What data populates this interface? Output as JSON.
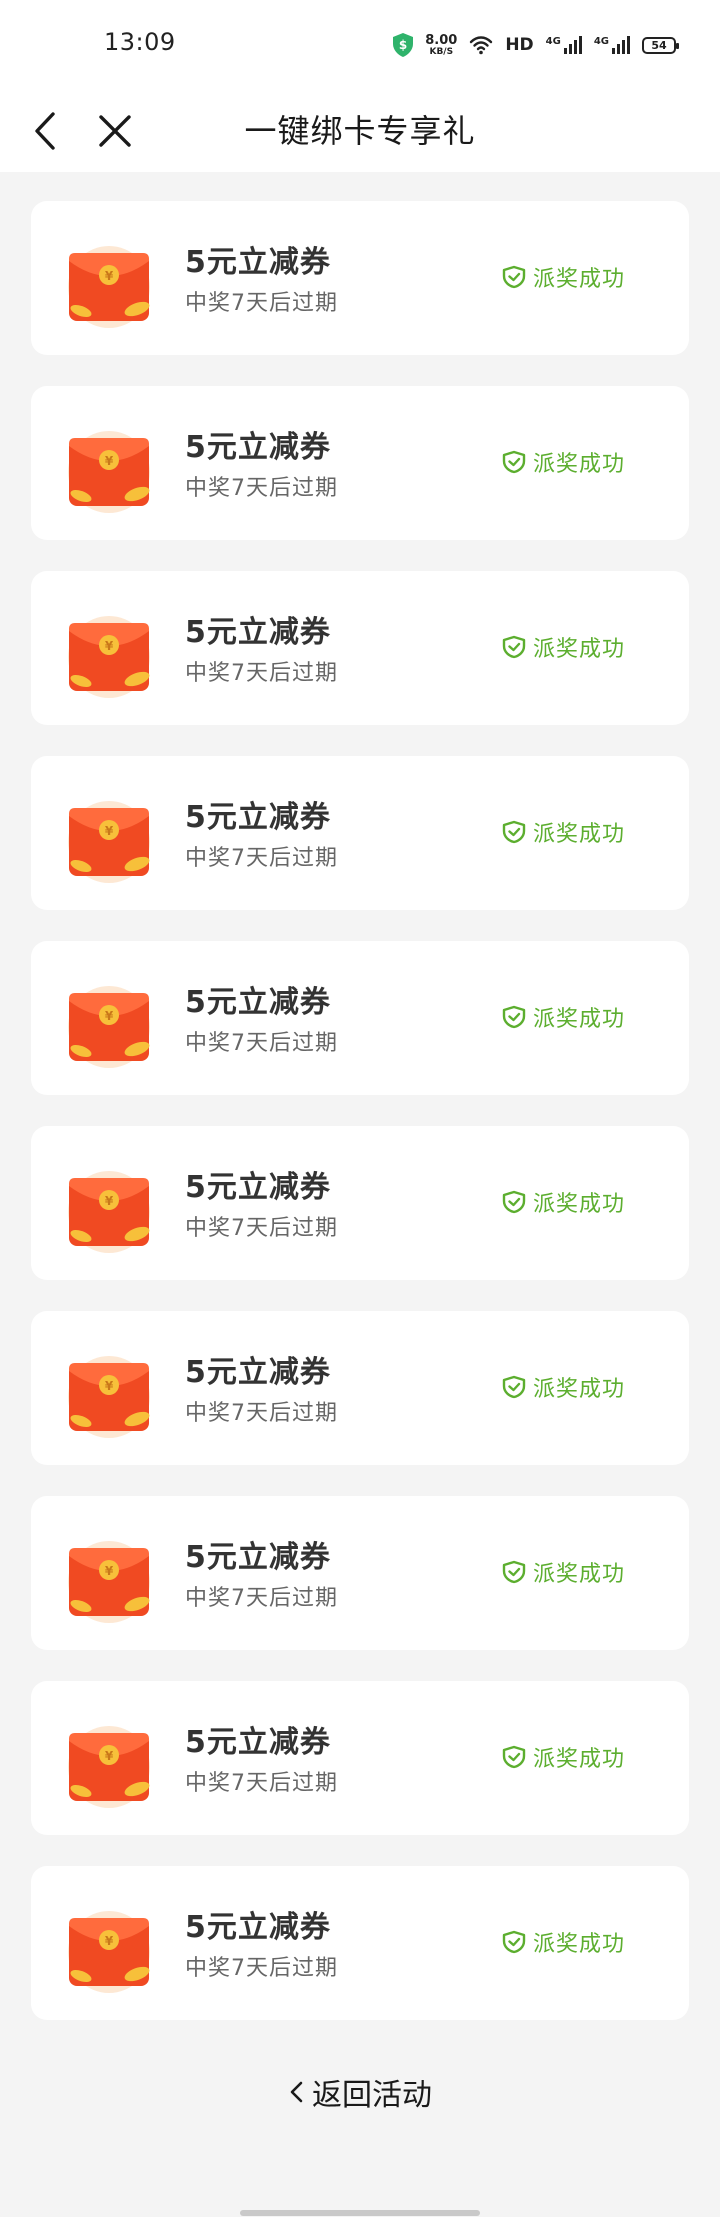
{
  "status_bar": {
    "time": "13:09",
    "net_speed_value": "8.00",
    "net_speed_unit": "KB/S",
    "hd_label": "HD",
    "signal1_label": "4G",
    "signal2_label": "4G",
    "battery_level": "54"
  },
  "nav": {
    "title": "一键绑卡专享礼"
  },
  "rewards": [
    {
      "title": "5元立减券",
      "subtitle": "中奖7天后过期",
      "status": "派奖成功"
    },
    {
      "title": "5元立减券",
      "subtitle": "中奖7天后过期",
      "status": "派奖成功"
    },
    {
      "title": "5元立减券",
      "subtitle": "中奖7天后过期",
      "status": "派奖成功"
    },
    {
      "title": "5元立减券",
      "subtitle": "中奖7天后过期",
      "status": "派奖成功"
    },
    {
      "title": "5元立减券",
      "subtitle": "中奖7天后过期",
      "status": "派奖成功"
    },
    {
      "title": "5元立减券",
      "subtitle": "中奖7天后过期",
      "status": "派奖成功"
    },
    {
      "title": "5元立减券",
      "subtitle": "中奖7天后过期",
      "status": "派奖成功"
    },
    {
      "title": "5元立减券",
      "subtitle": "中奖7天后过期",
      "status": "派奖成功"
    },
    {
      "title": "5元立减券",
      "subtitle": "中奖7天后过期",
      "status": "派奖成功"
    },
    {
      "title": "5元立减券",
      "subtitle": "中奖7天后过期",
      "status": "派奖成功"
    }
  ],
  "footer": {
    "return_label": "返回活动"
  },
  "colors": {
    "success_green": "#5cae2f",
    "envelope_red": "#f04a22",
    "coin_gold": "#f7c03a",
    "page_bg": "#f4f4f4"
  },
  "icons": {
    "back": "chevron-left-icon",
    "close": "close-icon",
    "reward": "red-envelope-icon",
    "status": "shield-check-icon",
    "return": "chevron-left-icon"
  }
}
